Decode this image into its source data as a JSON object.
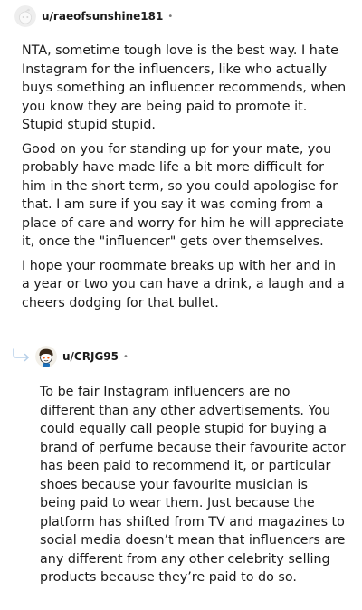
{
  "comments": [
    {
      "username": "u/raeofsunshine181",
      "separator": "•",
      "paragraphs": [
        "NTA, sometime tough love is the best way. I hate Instagram for the influencers, like who actually buys something an influencer recommends, when you know they are being paid to promote it. Stupid stupid stupid.",
        "Good on you for standing up for your mate, you probably have made life a bit more difficult for him in the short term, so you could apologise for that. I am sure if you say it was coming from a place of care and worry for him he will appreciate it, once the \"influencer\" gets over themselves.",
        "I hope your roommate breaks up with her and in a year or two you can have a drink, a laugh and a cheers dodging for that bullet."
      ]
    },
    {
      "username": "u/CRJG95",
      "separator": "•",
      "paragraphs": [
        "To be fair Instagram influencers are no different than any other advertisements. You could equally call people stupid for buying a brand of perfume because their favourite actor has been paid to recommend it, or particular shoes because your favourite musician is being paid to wear them. Just because the platform has shifted from TV and magazines to social media doesn’t mean that influencers are any different from any other celebrity selling products because they’re paid to do so."
      ]
    }
  ],
  "icons": {
    "avatar1": "snoo-avatar-icon",
    "avatar2": "snoo-avatar-icon",
    "reply": "reply-arrow-icon"
  },
  "colors": {
    "text": "#1c1c1c",
    "meta": "#7c7c7c",
    "reply_arrow": "#b6cfe8"
  }
}
